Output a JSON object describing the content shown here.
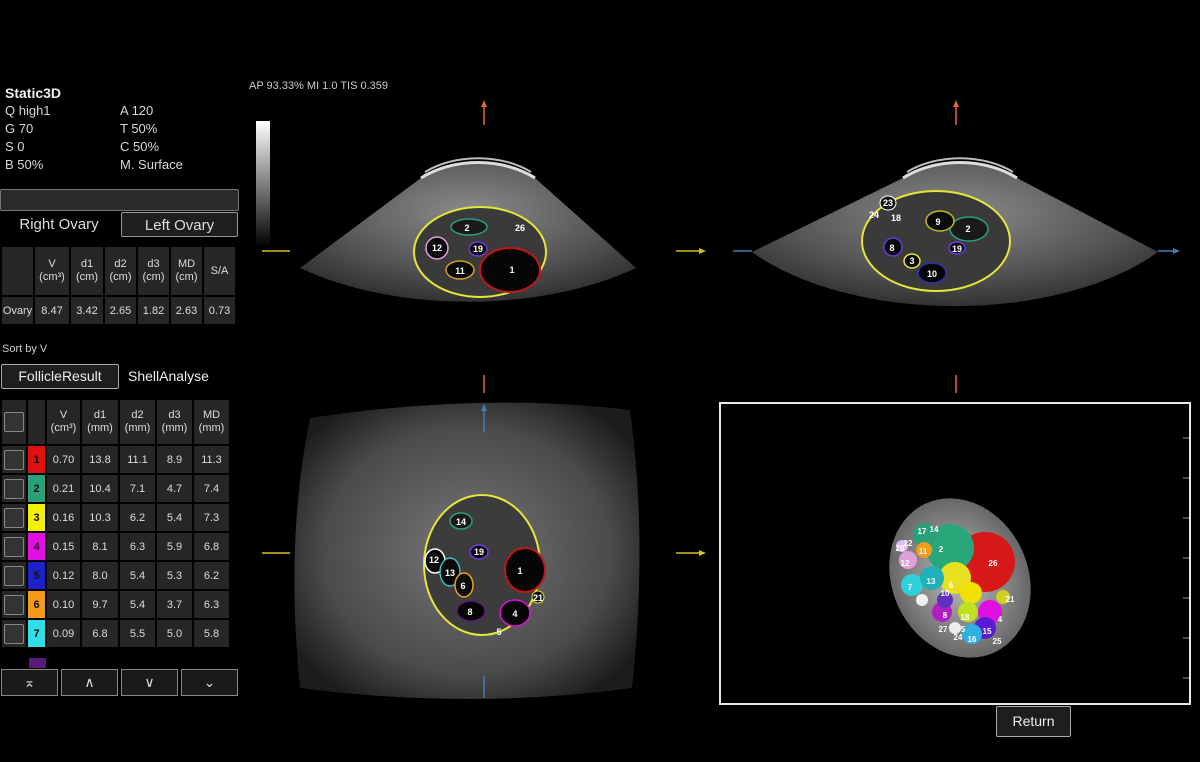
{
  "params": {
    "mode": "Static3D",
    "left_col": [
      "Q high1",
      "G 70",
      "S 0",
      "B 50%"
    ],
    "right_col": [
      "A 120",
      "T 50%",
      "C 50%",
      "M. Surface"
    ]
  },
  "side_tabs": {
    "right": "Right Ovary",
    "left": "Left Ovary"
  },
  "ovary_table": {
    "headers": [
      {
        "l1": "V",
        "l2": "(cm³)"
      },
      {
        "l1": "d1",
        "l2": "(cm)"
      },
      {
        "l1": "d2",
        "l2": "(cm)"
      },
      {
        "l1": "d3",
        "l2": "(cm)"
      },
      {
        "l1": "MD",
        "l2": "(cm)"
      },
      {
        "l1": "S/A",
        "l2": ""
      }
    ],
    "row_label": "Ovary",
    "values": [
      "8.47",
      "3.42",
      "2.65",
      "1.82",
      "2.63",
      "0.73"
    ]
  },
  "sort_label": "Sort by V",
  "result_tabs": {
    "follicle": "FollicleResult",
    "shell": "ShellAnalyse"
  },
  "follicle_table": {
    "headers": [
      {
        "l1": "V",
        "l2": "(cm³)"
      },
      {
        "l1": "d1",
        "l2": "(mm)"
      },
      {
        "l1": "d2",
        "l2": "(mm)"
      },
      {
        "l1": "d3",
        "l2": "(mm)"
      },
      {
        "l1": "MD",
        "l2": "(mm)"
      }
    ],
    "rows": [
      {
        "id": "1",
        "color": "#e01010",
        "text": "#111",
        "v": "0.70",
        "d1": "13.8",
        "d2": "11.1",
        "d3": "8.9",
        "md": "11.3"
      },
      {
        "id": "2",
        "color": "#2aa07a",
        "text": "#111",
        "v": "0.21",
        "d1": "10.4",
        "d2": "7.1",
        "d3": "4.7",
        "md": "7.4"
      },
      {
        "id": "3",
        "color": "#f2f200",
        "text": "#111",
        "v": "0.16",
        "d1": "10.3",
        "d2": "6.2",
        "d3": "5.4",
        "md": "7.3"
      },
      {
        "id": "4",
        "color": "#e010e0",
        "text": "#111",
        "v": "0.15",
        "d1": "8.1",
        "d2": "6.3",
        "d3": "5.9",
        "md": "6.8"
      },
      {
        "id": "5",
        "color": "#1a22c8",
        "text": "#111",
        "v": "0.12",
        "d1": "8.0",
        "d2": "5.4",
        "d3": "5.3",
        "md": "6.2"
      },
      {
        "id": "6",
        "color": "#f29a1a",
        "text": "#111",
        "v": "0.10",
        "d1": "9.7",
        "d2": "5.4",
        "d3": "3.7",
        "md": "6.3"
      },
      {
        "id": "7",
        "color": "#30e0e8",
        "text": "#111",
        "v": "0.09",
        "d1": "6.8",
        "d2": "5.5",
        "d3": "5.0",
        "md": "5.8"
      }
    ]
  },
  "nav_buttons": [
    "⌅",
    "∧",
    "∨",
    "⌄"
  ],
  "acq_info": "AP 93.33%  MI 1.0 TIS 0.359",
  "view_labels": {
    "a": [
      "2",
      "26",
      "12",
      "19",
      "11",
      "1"
    ],
    "b": [
      "23",
      "24",
      "18",
      "9",
      "2",
      "8",
      "19",
      "3",
      "10"
    ],
    "c": [
      "14",
      "12",
      "19",
      "13",
      "6",
      "1",
      "21",
      "8",
      "4",
      "5"
    ],
    "render": [
      "17",
      "14",
      "22",
      "20",
      "11",
      "2",
      "12",
      "26",
      "7",
      "13",
      "6",
      "21",
      "10",
      "8",
      "18",
      "27",
      "5",
      "24",
      "16",
      "4",
      "15",
      "25"
    ]
  },
  "return_label": "Return"
}
